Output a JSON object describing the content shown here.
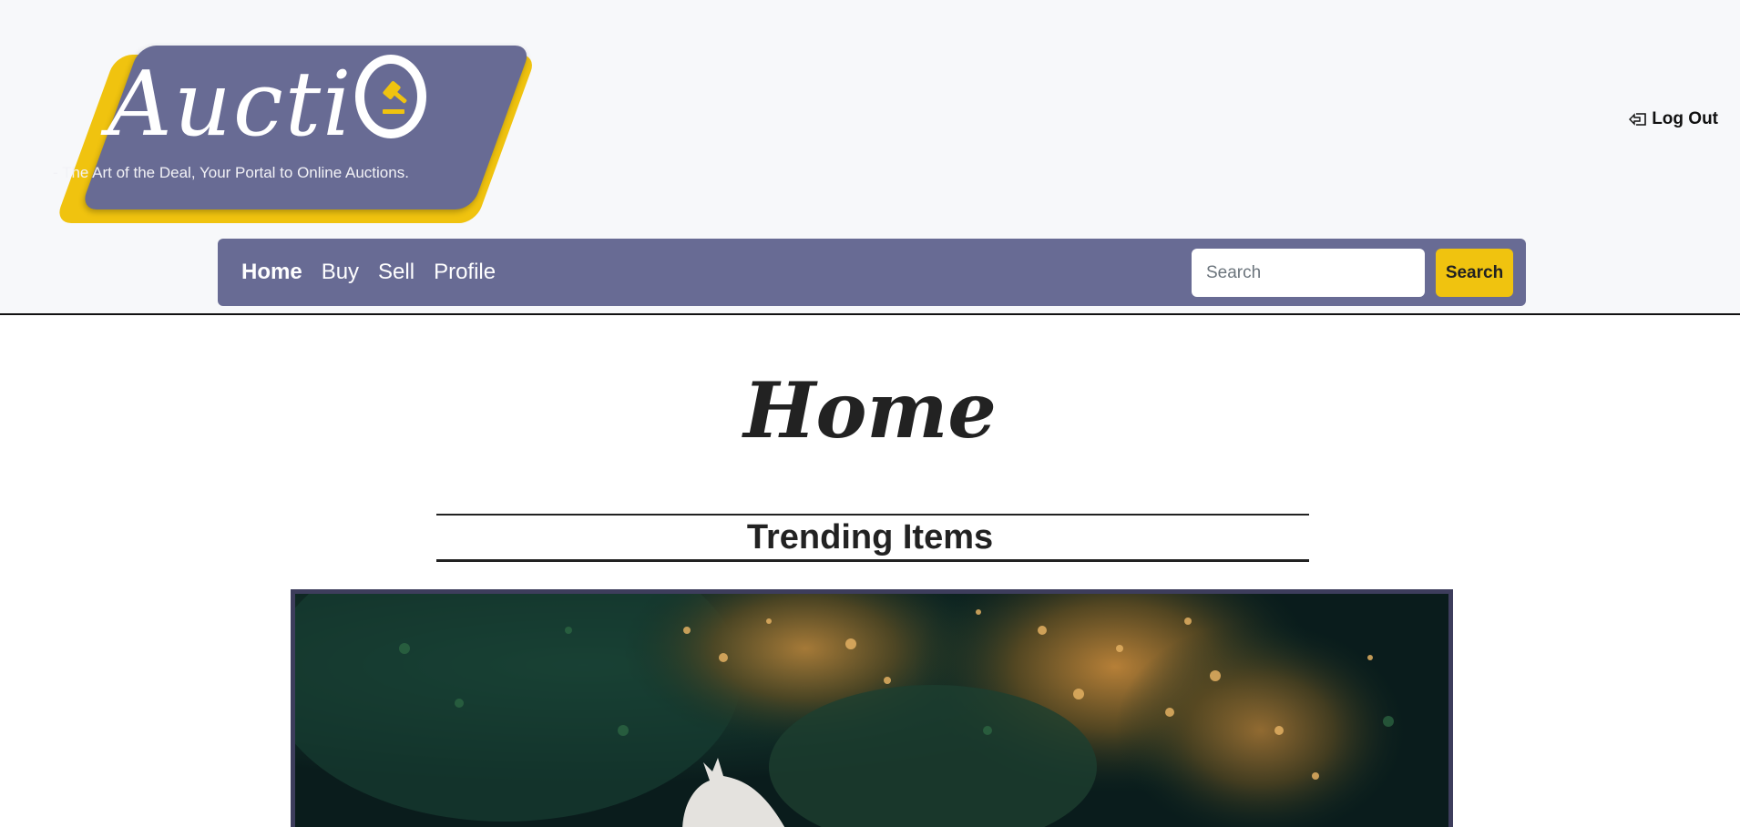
{
  "logo": {
    "wordmark_before": "Aucti",
    "wordmark_o": "O",
    "tagline": "- The Art of the Deal, Your Portal to Online Auctions."
  },
  "header": {
    "logout_label": "Log Out",
    "logout_icon": "logout-icon"
  },
  "nav": {
    "links": [
      {
        "label": "Home",
        "active": true
      },
      {
        "label": "Buy",
        "active": false
      },
      {
        "label": "Sell",
        "active": false
      },
      {
        "label": "Profile",
        "active": false
      }
    ],
    "search_placeholder": "Search",
    "search_button": "Search"
  },
  "main": {
    "title": "Home",
    "section_title": "Trending Items"
  },
  "colors": {
    "brand_purple": "#686b94",
    "accent_yellow": "#f0c30f"
  }
}
